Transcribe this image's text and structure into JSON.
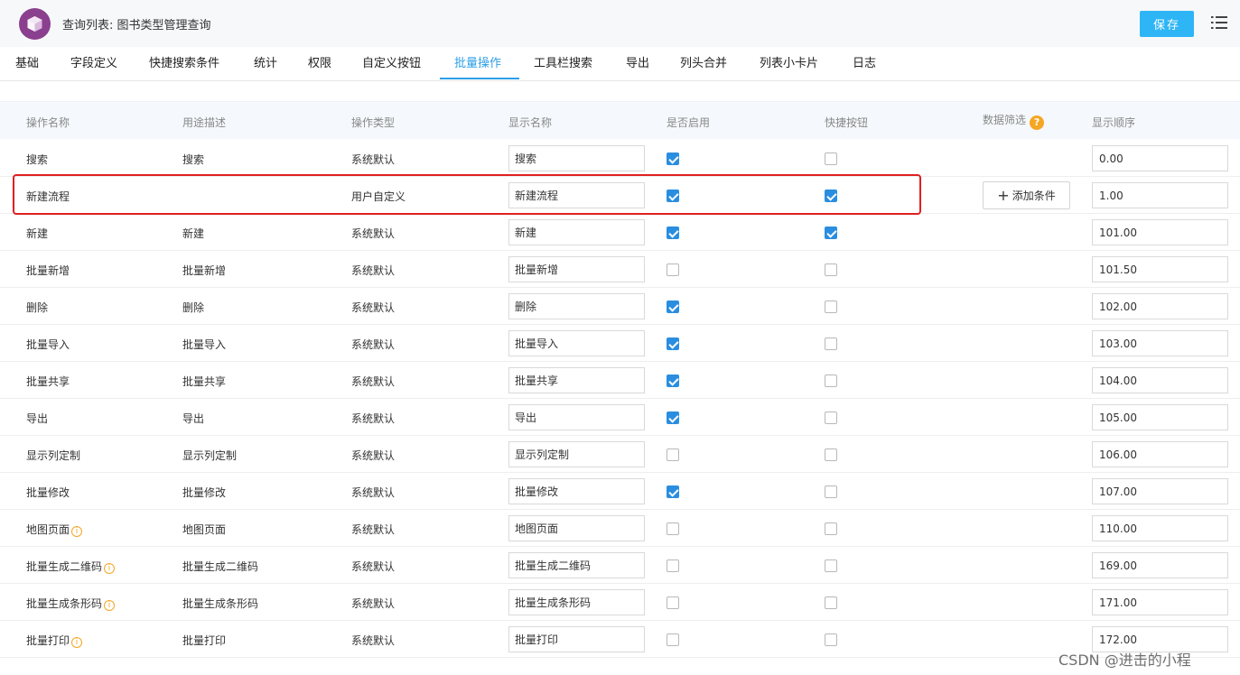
{
  "header": {
    "title": "查询列表: 图书类型管理查询",
    "save_label": "保存"
  },
  "tabs": [
    {
      "label": "基础",
      "active": false
    },
    {
      "label": "字段定义",
      "active": false
    },
    {
      "label": "快捷搜索条件",
      "active": false
    },
    {
      "label": "统计",
      "active": false
    },
    {
      "label": "权限",
      "active": false
    },
    {
      "label": "自定义按钮",
      "active": false
    },
    {
      "label": "批量操作",
      "active": true
    },
    {
      "label": "工具栏搜索",
      "active": false
    },
    {
      "label": "导出",
      "active": false
    },
    {
      "label": "列头合并",
      "active": false
    },
    {
      "label": "列表小卡片",
      "active": false
    },
    {
      "label": "日志",
      "active": false
    }
  ],
  "table": {
    "columns": {
      "name": "操作名称",
      "desc": "用途描述",
      "type": "操作类型",
      "display": "显示名称",
      "enabled": "是否启用",
      "shortcut": "快捷按钮",
      "filter": "数据筛选",
      "order": "显示顺序"
    },
    "add_condition_label": "添加条件",
    "rows": [
      {
        "name": "搜索",
        "desc": "搜索",
        "type": "系统默认",
        "display": "搜索",
        "enabled": true,
        "shortcut": false,
        "order": "0.00",
        "info": false,
        "add_condition": false
      },
      {
        "name": "新建流程",
        "desc": "",
        "type": "用户自定义",
        "display": "新建流程",
        "enabled": true,
        "shortcut": true,
        "order": "1.00",
        "info": false,
        "add_condition": true
      },
      {
        "name": "新建",
        "desc": "新建",
        "type": "系统默认",
        "display": "新建",
        "enabled": true,
        "shortcut": true,
        "order": "101.00",
        "info": false,
        "add_condition": false
      },
      {
        "name": "批量新增",
        "desc": "批量新增",
        "type": "系统默认",
        "display": "批量新增",
        "enabled": false,
        "shortcut": false,
        "order": "101.50",
        "info": false,
        "add_condition": false
      },
      {
        "name": "删除",
        "desc": "删除",
        "type": "系统默认",
        "display": "删除",
        "enabled": true,
        "shortcut": false,
        "order": "102.00",
        "info": false,
        "add_condition": false
      },
      {
        "name": "批量导入",
        "desc": "批量导入",
        "type": "系统默认",
        "display": "批量导入",
        "enabled": true,
        "shortcut": false,
        "order": "103.00",
        "info": false,
        "add_condition": false
      },
      {
        "name": "批量共享",
        "desc": "批量共享",
        "type": "系统默认",
        "display": "批量共享",
        "enabled": true,
        "shortcut": false,
        "order": "104.00",
        "info": false,
        "add_condition": false
      },
      {
        "name": "导出",
        "desc": "导出",
        "type": "系统默认",
        "display": "导出",
        "enabled": true,
        "shortcut": false,
        "order": "105.00",
        "info": false,
        "add_condition": false
      },
      {
        "name": "显示列定制",
        "desc": "显示列定制",
        "type": "系统默认",
        "display": "显示列定制",
        "enabled": false,
        "shortcut": false,
        "order": "106.00",
        "info": false,
        "add_condition": false
      },
      {
        "name": "批量修改",
        "desc": "批量修改",
        "type": "系统默认",
        "display": "批量修改",
        "enabled": true,
        "shortcut": false,
        "order": "107.00",
        "info": false,
        "add_condition": false
      },
      {
        "name": "地图页面",
        "desc": "地图页面",
        "type": "系统默认",
        "display": "地图页面",
        "enabled": false,
        "shortcut": false,
        "order": "110.00",
        "info": true,
        "add_condition": false
      },
      {
        "name": "批量生成二维码",
        "desc": "批量生成二维码",
        "type": "系统默认",
        "display": "批量生成二维码",
        "enabled": false,
        "shortcut": false,
        "order": "169.00",
        "info": true,
        "add_condition": false
      },
      {
        "name": "批量生成条形码",
        "desc": "批量生成条形码",
        "type": "系统默认",
        "display": "批量生成条形码",
        "enabled": false,
        "shortcut": false,
        "order": "171.00",
        "info": true,
        "add_condition": false
      },
      {
        "name": "批量打印",
        "desc": "批量打印",
        "type": "系统默认",
        "display": "批量打印",
        "enabled": false,
        "shortcut": false,
        "order": "172.00",
        "info": true,
        "add_condition": false
      }
    ]
  },
  "watermark": "CSDN @进击的小程",
  "colors": {
    "accent": "#2e9fe6",
    "save_button": "#2eb5f5",
    "checkbox_on": "#2a8ee0",
    "highlight_border": "#e02020",
    "logo": "#8a3f8f",
    "help": "#f5a623"
  }
}
